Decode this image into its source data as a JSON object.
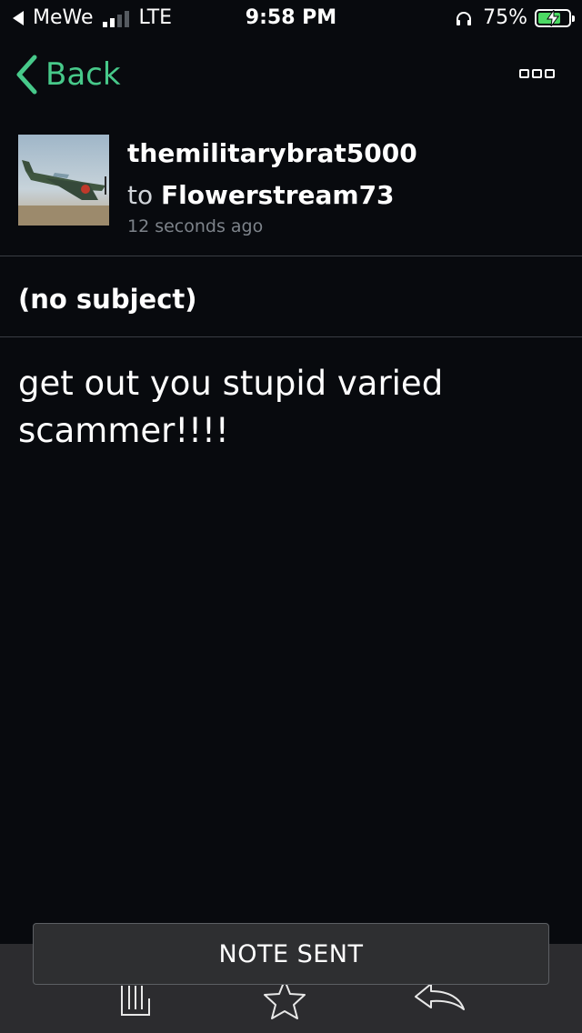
{
  "status_bar": {
    "carrier_back": "MeWe",
    "network": "LTE",
    "time": "9:58 PM",
    "battery_percent": "75%",
    "battery_level": 0.75,
    "signal_bars_active": 2,
    "signal_bars_total": 4
  },
  "nav": {
    "back_label": "Back",
    "accent_color": "#47c98a",
    "more_icon": "more-icon"
  },
  "message": {
    "sender": "themilitarybrat5000",
    "to_prefix": "to",
    "recipient": "Flowerstream73",
    "timestamp": "12 seconds ago",
    "subject": "(no subject)",
    "body": "get out you stupid varied scammer!!!!"
  },
  "toolbar": {
    "icons": [
      "archive-icon",
      "star-icon",
      "reply-icon"
    ]
  },
  "toast": {
    "text": "NOTE SENT"
  }
}
